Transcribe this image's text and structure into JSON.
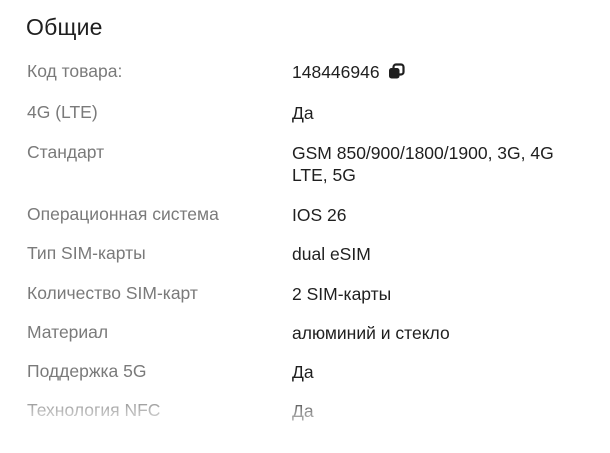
{
  "section": {
    "title": "Общие"
  },
  "specs": [
    {
      "label": "Код товара:",
      "value": "148446946",
      "icon": "copy-icon"
    },
    {
      "label": "4G (LTE)",
      "value": "Да"
    },
    {
      "label": "Стандарт",
      "value": "GSM 850/900/1800/1900, 3G, 4G LTE, 5G"
    },
    {
      "label": "Операционная система",
      "value": "IOS 26"
    },
    {
      "label": "Тип SIM-карты",
      "value": "dual eSIM"
    },
    {
      "label": "Количество SIM-карт",
      "value": "2 SIM-карты"
    },
    {
      "label": "Материал",
      "value": "алюминий и стекло"
    },
    {
      "label": "Поддержка 5G",
      "value": "Да"
    },
    {
      "label": "Технология NFC",
      "value": "Да"
    }
  ]
}
